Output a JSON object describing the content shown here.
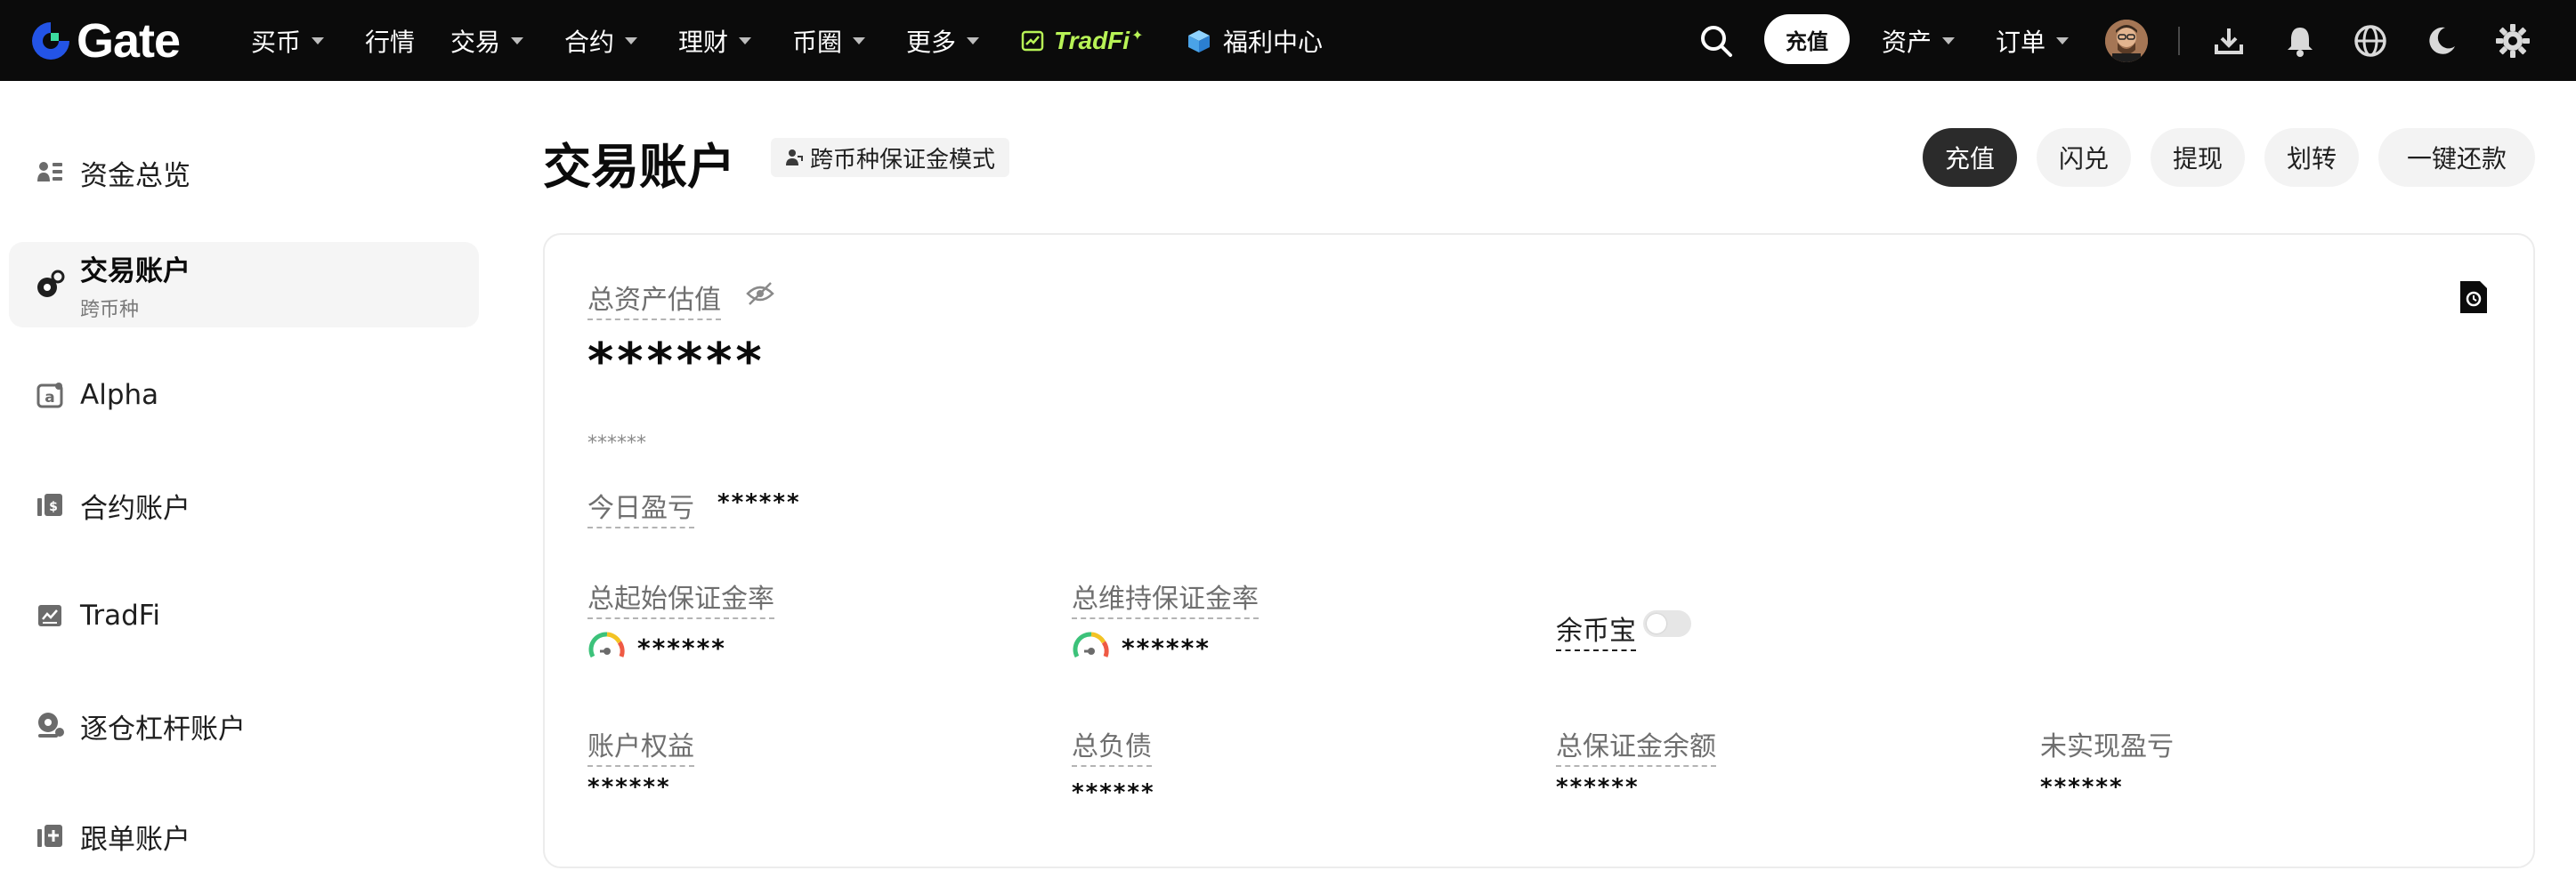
{
  "header": {
    "logo_text": "Gate",
    "nav": [
      {
        "label": "买币",
        "dropdown": true
      },
      {
        "label": "行情",
        "dropdown": false
      },
      {
        "label": "交易",
        "dropdown": true
      },
      {
        "label": "合约",
        "dropdown": true
      },
      {
        "label": "理财",
        "dropdown": true
      },
      {
        "label": "币圈",
        "dropdown": true
      },
      {
        "label": "更多",
        "dropdown": true
      }
    ],
    "tradfi_label": "TradFi",
    "welfare_label": "福利中心",
    "deposit_label": "充值",
    "assets_label": "资产",
    "orders_label": "订单",
    "icons": [
      "search-icon",
      "download-icon",
      "bell-icon",
      "globe-icon",
      "moon-icon",
      "gear-icon"
    ],
    "colors": {
      "bar_bg": "#0b0b0b",
      "tradfi_accent": "#b8f356",
      "logo_blue": "#2354e6"
    }
  },
  "sidebar": {
    "items": [
      {
        "label": "资金总览",
        "icon": "wallet-overview-icon"
      },
      {
        "label": "交易账户",
        "sub": "跨币种",
        "icon": "trade-account-icon",
        "active": true
      },
      {
        "label": "Alpha",
        "icon": "alpha-icon"
      },
      {
        "label": "合约账户",
        "icon": "futures-icon"
      },
      {
        "label": "TradFi",
        "icon": "tradfi-icon"
      },
      {
        "label": "逐仓杠杆账户",
        "icon": "margin-icon"
      },
      {
        "label": "跟单账户",
        "icon": "copy-trade-icon"
      }
    ]
  },
  "page": {
    "title": "交易账户",
    "mode_badge": "跨币种保证金模式",
    "actions": [
      "充值",
      "闪兑",
      "提现",
      "划转",
      "一键还款"
    ]
  },
  "card": {
    "total_label": "总资产估值",
    "total_value": "******",
    "sub_value": "******",
    "today_pnl_label": "今日盈亏",
    "today_pnl_value": "******",
    "init_margin_label": "总起始保证金率",
    "init_margin_value": "******",
    "maint_margin_label": "总维持保证金率",
    "maint_margin_value": "******",
    "yubibao_label": "余币宝",
    "yubibao_enabled": false,
    "equity_label": "账户权益",
    "equity_value": "******",
    "liabilities_label": "总负债",
    "liabilities_value": "******",
    "margin_balance_label": "总保证金余额",
    "margin_balance_value": "******",
    "unrealized_label": "未实现盈亏",
    "unrealized_value": "******"
  }
}
